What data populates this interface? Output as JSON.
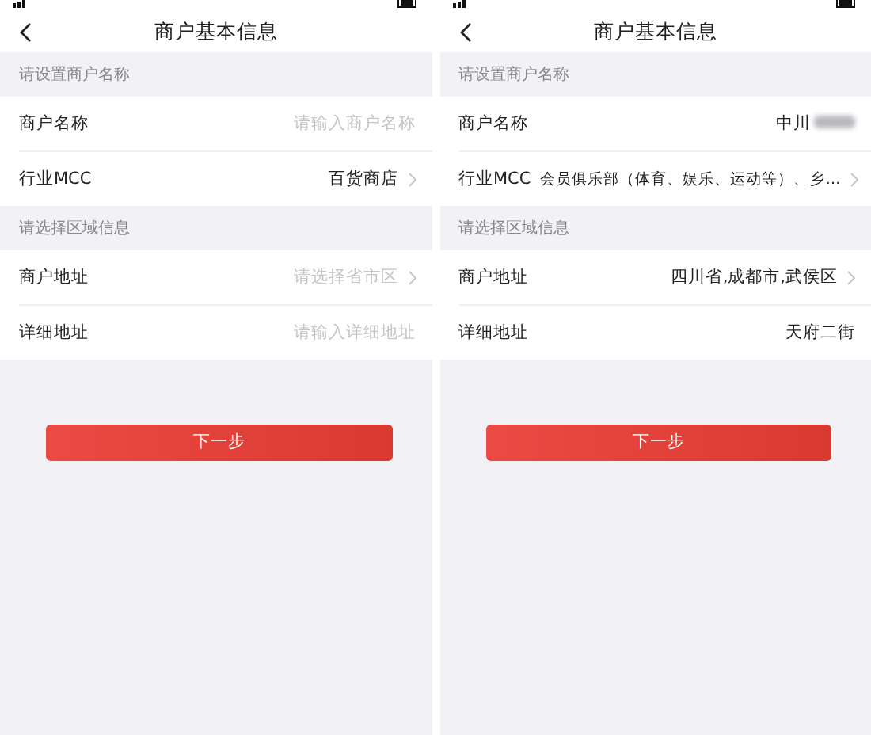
{
  "screens": [
    {
      "title": "商户基本信息",
      "sections": [
        {
          "header": "请设置商户名称",
          "rows": [
            {
              "label": "商户名称",
              "placeholder": "请输入商户名称",
              "chevron": false,
              "redacted": false
            },
            {
              "label": "行业MCC",
              "value": "百货商店",
              "chevron": true,
              "redacted": false
            }
          ]
        },
        {
          "header": "请选择区域信息",
          "rows": [
            {
              "label": "商户地址",
              "placeholder": "请选择省市区",
              "chevron": true,
              "redacted": false
            },
            {
              "label": "详细地址",
              "placeholder": "请输入详细地址",
              "chevron": false,
              "redacted": false
            }
          ]
        }
      ],
      "button": "下一步"
    },
    {
      "title": "商户基本信息",
      "sections": [
        {
          "header": "请设置商户名称",
          "rows": [
            {
              "label": "商户名称",
              "value": "中川",
              "chevron": false,
              "redacted": true
            },
            {
              "label": "行业MCC",
              "value": "会员俱乐部（体育、娱乐、运动等）、乡…",
              "chevron": true,
              "redacted": false
            }
          ]
        },
        {
          "header": "请选择区域信息",
          "rows": [
            {
              "label": "商户地址",
              "value": "四川省,成都市,武侯区",
              "chevron": true,
              "redacted": false
            },
            {
              "label": "详细地址",
              "value": "天府二街",
              "chevron": false,
              "redacted": false
            }
          ]
        }
      ],
      "button": "下一步"
    }
  ]
}
